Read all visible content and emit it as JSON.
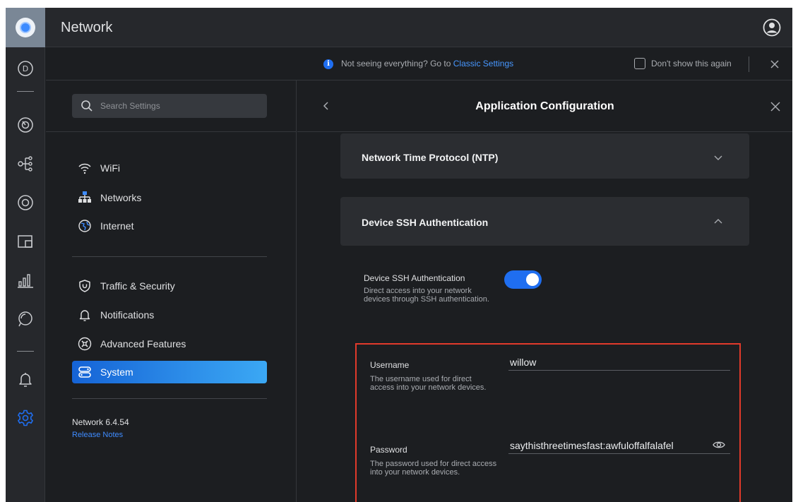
{
  "app": {
    "title": "Network"
  },
  "rail": {
    "icons": [
      "dashboard-icon",
      "devices-icon",
      "topology-icon",
      "clients-icon",
      "statistics-icon",
      "insights-icon",
      "radar-icon",
      "alerts-icon",
      "settings-icon"
    ]
  },
  "notice": {
    "text": "Not seeing everything? Go to ",
    "link": "Classic Settings",
    "dont_show": "Don't show this again"
  },
  "sidebar": {
    "search_placeholder": "Search Settings",
    "items": [
      {
        "label": "WiFi",
        "icon": "wifi-icon"
      },
      {
        "label": "Networks",
        "icon": "networks-icon"
      },
      {
        "label": "Internet",
        "icon": "internet-icon"
      },
      {
        "label": "Traffic & Security",
        "icon": "shield-icon"
      },
      {
        "label": "Notifications",
        "icon": "bell-icon"
      },
      {
        "label": "Advanced Features",
        "icon": "advanced-features-icon"
      },
      {
        "label": "System",
        "icon": "system-icon",
        "active": true
      }
    ],
    "version": "Network 6.4.54",
    "release_notes": "Release Notes"
  },
  "panel": {
    "title": "Application Configuration",
    "sections": [
      {
        "title": "Network Time Protocol (NTP)",
        "expanded": false
      },
      {
        "title": "Device SSH Authentication",
        "expanded": true
      }
    ],
    "ssh": {
      "label": "Device SSH Authentication",
      "description": "Direct access into your network devices through SSH authentication.",
      "enabled": true
    },
    "username": {
      "label": "Username",
      "description": "The username used for direct access into your network devices.",
      "value": "willow"
    },
    "password": {
      "label": "Password",
      "description": "The password used for direct access into your network devices.",
      "value": "saythisthreetimesfast:awfuloffalfalafel"
    }
  },
  "colors": {
    "accent": "#1f6ef0",
    "link": "#4797ff",
    "highlight": "#e13a2b",
    "background": "#1c1e21",
    "card": "#2b2d31"
  }
}
